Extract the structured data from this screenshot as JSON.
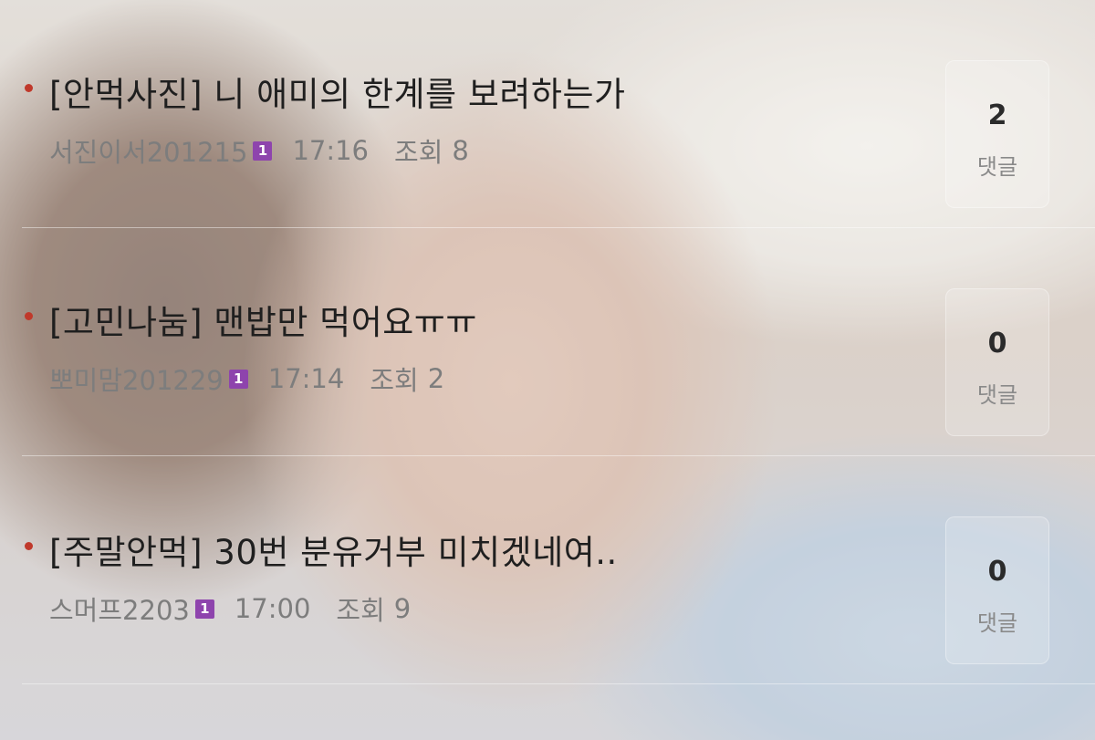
{
  "posts": [
    {
      "title": "[안먹사진] 니 애미의 한계를 보려하는가",
      "author": "서진이서201215",
      "badge": "1",
      "time": "17:16",
      "views_label": "조회",
      "views": "8",
      "comment_count": "2",
      "comment_label": "댓글"
    },
    {
      "title": "[고민나눔] 맨밥만 먹어요ㅠㅠ",
      "author": "뽀미맘201229",
      "badge": "1",
      "time": "17:14",
      "views_label": "조회",
      "views": "2",
      "comment_count": "0",
      "comment_label": "댓글"
    },
    {
      "title": "[주말안먹] 30번 분유거부 미치겠네여..",
      "author": "스머프2203",
      "badge": "1",
      "time": "17:00",
      "views_label": "조회",
      "views": "9",
      "comment_count": "0",
      "comment_label": "댓글"
    }
  ],
  "colors": {
    "bullet": "#c0392b",
    "badge": "#8e44ad"
  }
}
